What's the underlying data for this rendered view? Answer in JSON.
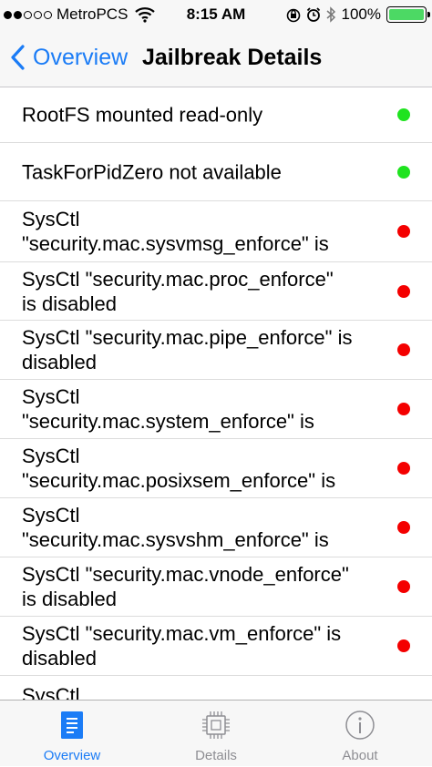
{
  "status_bar": {
    "carrier": "MetroPCS",
    "signal_bars_filled": 2,
    "signal_bars_total": 5,
    "time": "8:15 AM",
    "battery": "100%",
    "battery_level": 1.0,
    "icons": [
      "wifi-icon",
      "orientation-lock-icon",
      "alarm-icon",
      "bluetooth-icon",
      "battery-icon"
    ]
  },
  "nav": {
    "back_label": "Overview",
    "title": "Jailbreak Details"
  },
  "colors": {
    "accent": "#1b7cf6",
    "ok": "#1fe31f",
    "fail": "#f40000",
    "inactive": "#8e8e93"
  },
  "items": [
    {
      "label": "RootFS mounted read-only",
      "status": "ok"
    },
    {
      "label": "TaskForPidZero not available",
      "status": "ok"
    },
    {
      "label": "SysCtl\n\"security.mac.sysvmsg_enforce\" is",
      "status": "fail"
    },
    {
      "label": "SysCtl \"security.mac.proc_enforce\"\nis disabled",
      "status": "fail"
    },
    {
      "label": "SysCtl \"security.mac.pipe_enforce\" is\ndisabled",
      "status": "fail"
    },
    {
      "label": "SysCtl\n\"security.mac.system_enforce\" is",
      "status": "fail"
    },
    {
      "label": "SysCtl\n\"security.mac.posixsem_enforce\" is",
      "status": "fail"
    },
    {
      "label": "SysCtl\n\"security.mac.sysvshm_enforce\" is",
      "status": "fail"
    },
    {
      "label": "SysCtl \"security.mac.vnode_enforce\"\nis disabled",
      "status": "fail"
    },
    {
      "label": "SysCtl \"security.mac.vm_enforce\" is\ndisabled",
      "status": "fail"
    },
    {
      "label": "SysCtl",
      "status": "fail"
    }
  ],
  "tabs": [
    {
      "label": "Overview",
      "icon": "document-icon",
      "active": true
    },
    {
      "label": "Details",
      "icon": "chip-icon",
      "active": false
    },
    {
      "label": "About",
      "icon": "info-icon",
      "active": false
    }
  ]
}
